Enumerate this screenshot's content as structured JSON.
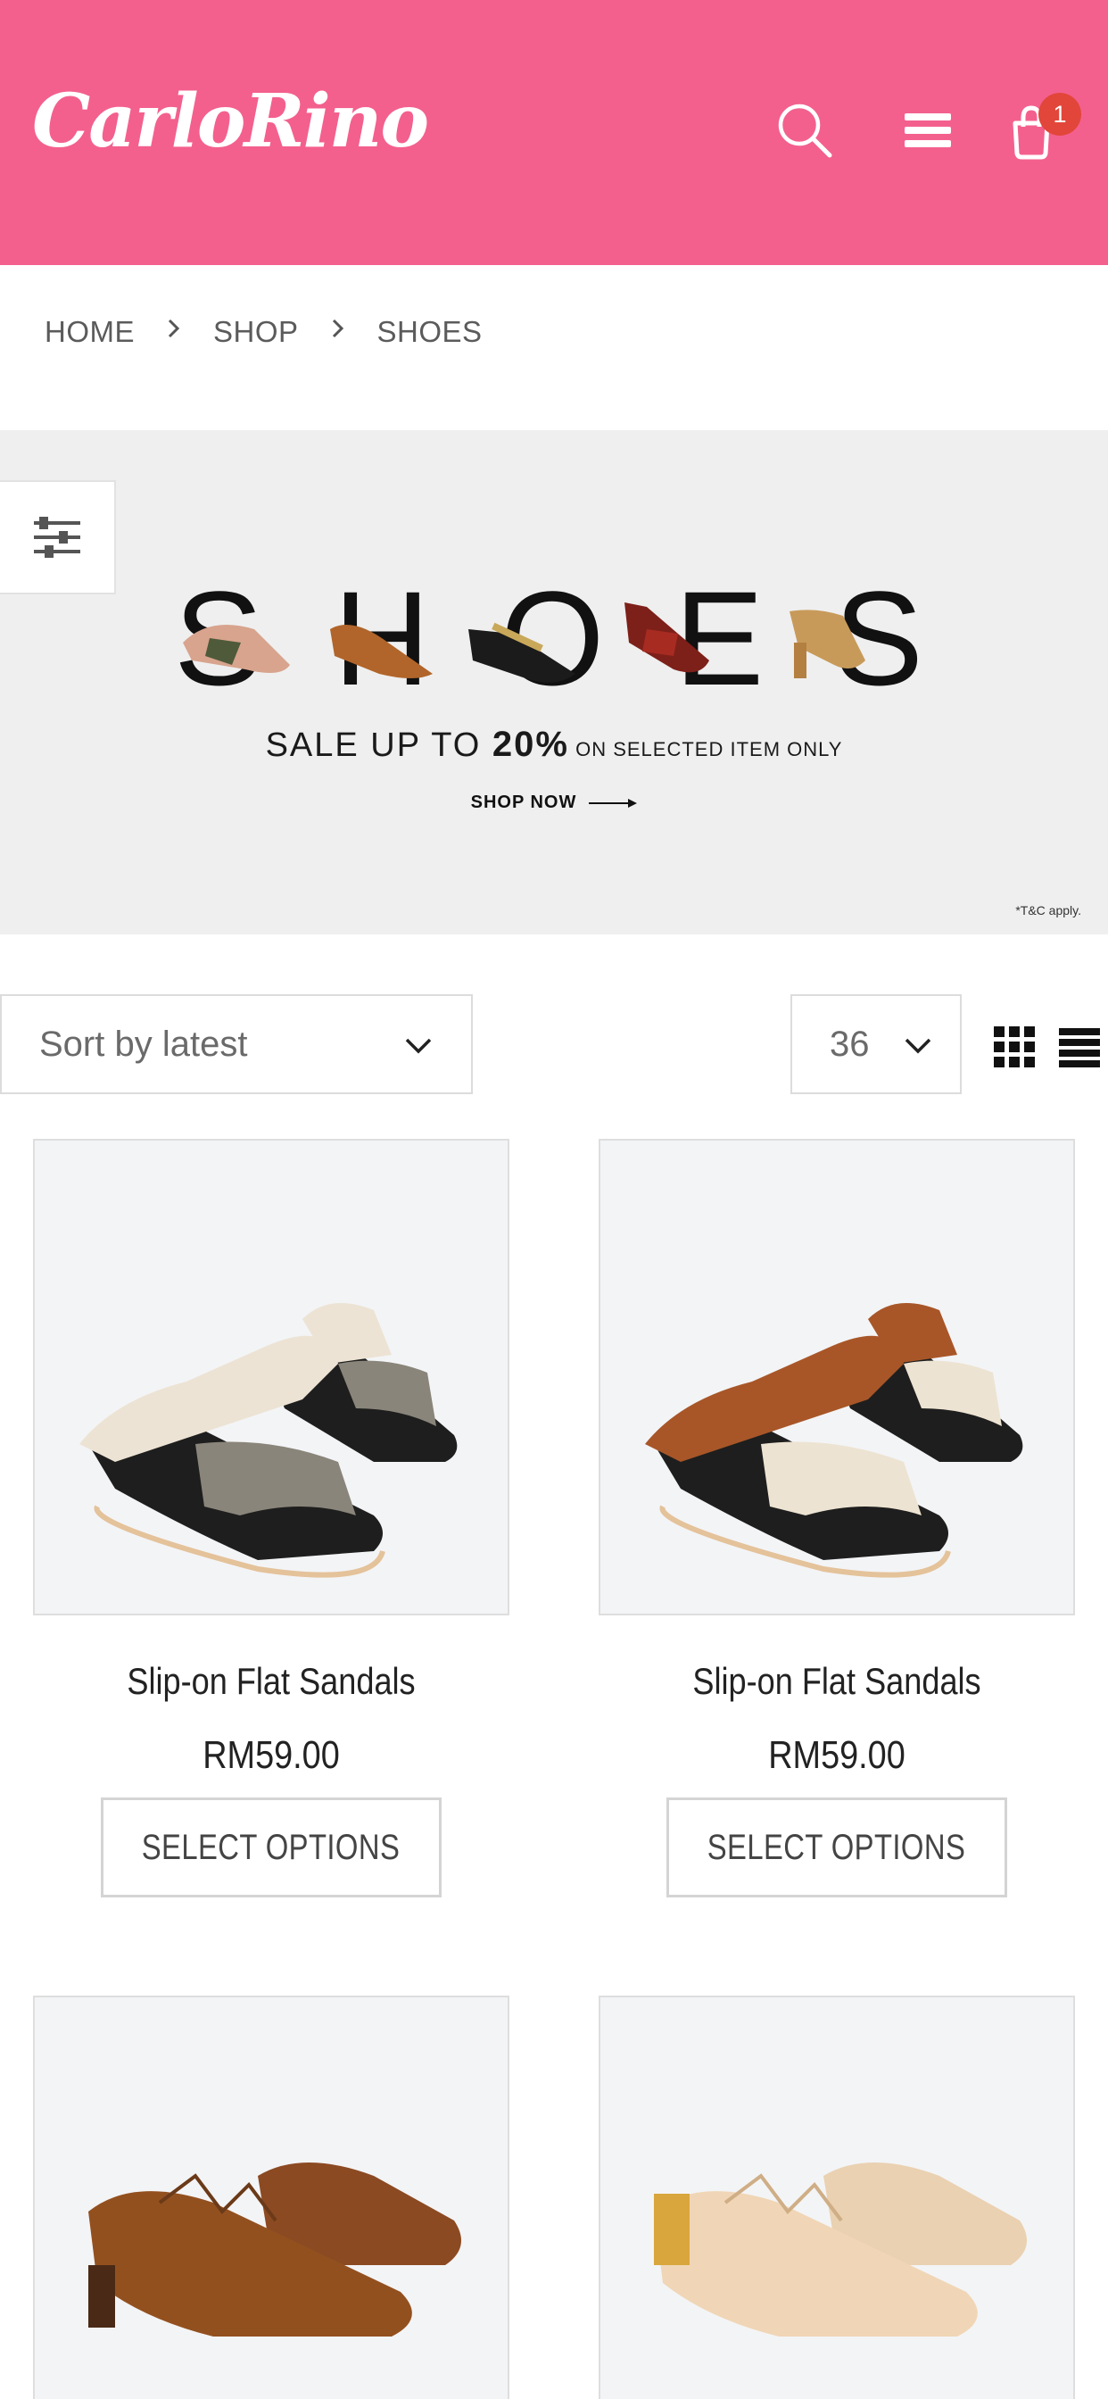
{
  "header": {
    "logo": "CarloRino",
    "cart_count": "1",
    "accent_color": "#f3608e",
    "badge_color": "#e2463a",
    "icons": [
      "search-icon",
      "menu-icon",
      "cart-icon"
    ]
  },
  "breadcrumb": [
    "HOME",
    "SHOP",
    "SHOES"
  ],
  "banner": {
    "word": [
      "S",
      "H",
      "O",
      "E",
      "S"
    ],
    "sale_prefix": "SALE UP TO ",
    "sale_percent": "20%",
    "sale_suffix": " ON SELECTED ITEM ONLY",
    "cta": "SHOP NOW",
    "terms": "*T&C apply."
  },
  "toolbar": {
    "sort_value": "Sort by latest",
    "per_page_value": "36"
  },
  "products": [
    {
      "name": "Slip-on Flat Sandals",
      "price": "RM59.00",
      "button": "SELECT OPTIONS"
    },
    {
      "name": "Slip-on Flat Sandals",
      "price": "RM59.00",
      "button": "SELECT OPTIONS"
    },
    {
      "name": "",
      "price": "",
      "button": ""
    },
    {
      "name": "",
      "price": "",
      "button": ""
    }
  ]
}
